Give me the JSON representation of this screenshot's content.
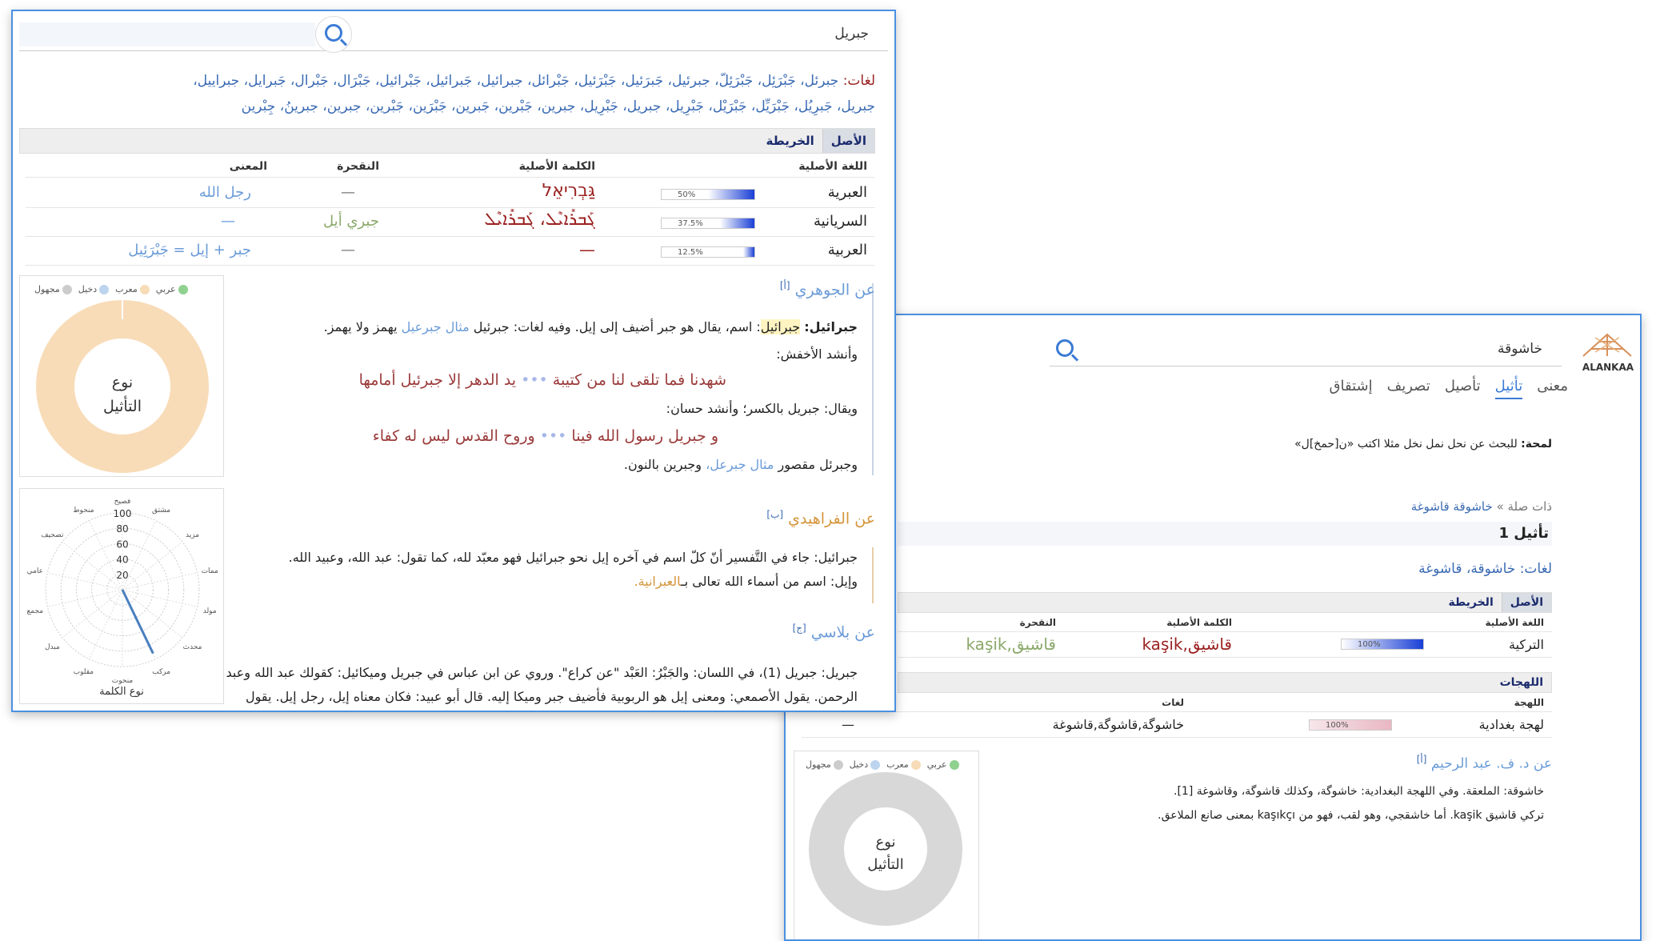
{
  "winA": {
    "search": {
      "query": "جبريل"
    },
    "variants_label": "لغات:",
    "variants_line1": "جبرئل، جَبْرَئِل، جَبْرَئِلّ، جبرئيل، جَبرَئيل، جَبْرَئيل، جَبْرائل، جبرائيل، جَبرائيل، جَبْرائيل، جَبْرَال، جَبْرال، جَبرايل، جبراييل،",
    "variants_line2": "جبريل، جَبرِيُل، جَبْرَيِّل، جَبْرَيْل، جَبْرِيل، جبريل، جَبْرِيل، جبرين، جَبْرين، جَبرين، جَبْرَين، جَبْرين، جبرين، جبرينُ، جِبْرين",
    "tabs": [
      "الأصل",
      "الخريطة"
    ],
    "table": {
      "headers": {
        "lang": "اللغة الأصلية",
        "word": "الكلمة الأصلية",
        "translit": "النقحرة",
        "meaning": "المعنى"
      },
      "rows": [
        {
          "lang": "العبرية",
          "pct": "50%",
          "fill": 0.5,
          "word": "גַּבְרִיאֵל",
          "translit": "—",
          "meaning": "رجل الله"
        },
        {
          "lang": "السريانية",
          "pct": "37.5%",
          "fill": 0.375,
          "word": "ܓܰܒܪܺܐܝܶܠ، ܓܰܒܪܺܐܝܶܠ",
          "translit": "جبري أيل",
          "meaning": "—"
        },
        {
          "lang": "العربية",
          "pct": "12.5%",
          "fill": 0.125,
          "word": "—",
          "translit": "—",
          "meaning": "جبر + إيل = جَبْرَئِيل"
        }
      ]
    },
    "legend": [
      "عربي",
      "معرب",
      "دخيل",
      "مجهول"
    ],
    "legend_colors": [
      "#8fd18f",
      "#f8dcb8",
      "#bcd4ee",
      "#cccccc"
    ],
    "donut_label": "نوع التأثيل",
    "donut_label1": "نوع",
    "donut_label2": "التأثيل",
    "radar": {
      "labels": [
        "فصيح",
        "مشتق",
        "مزيد",
        "ممات",
        "مولد",
        "محدث",
        "مركب",
        "منحوت",
        "مقلوب",
        "مبدل",
        "مجمع",
        "عامي",
        "تصحيف",
        "منحوط"
      ],
      "ticks": [
        "100",
        "80",
        "60",
        "40",
        "20"
      ],
      "caption": "نوع الكلمة"
    },
    "sec1": {
      "title": "عن الجوهري",
      "ref": "[أ]",
      "p1_bold": "جبرائيل:",
      "p1_hl": "جبرائيل",
      "p1_rest": ": اسم، يقال هو جبر أضيف إلى إيل. وفيه لغات: جبرئيل",
      "p1_link": "مثال جبرعيل",
      "p1_end": "يهمز ولا يهمز.",
      "p2": "وأنشد الأخفش:",
      "poem1_a": "شهدنا فما تلقى لنا من كتيبة",
      "poem1_b": "يد الدهر إلا جبرئيل أمامها",
      "p3": "ويقال: جبريل بالكسر؛ وأنشد حسان:",
      "poem2_a": "و جبريل رسول الله فينا",
      "poem2_b": "وروح القدس ليس له كفاء",
      "p4_a": "وجبرئل مقصور",
      "p4_link": "مثال جبرعل،",
      "p4_b": "وجبرين بالنون."
    },
    "sec2": {
      "title": "عن الفراهيدي",
      "ref": "[ب]",
      "p1": "جبرائيل: جاء في التَّفسير أنّ كلّ اسم في آخره إيل نحو جبرائيل فهو معبّد لله، كما تقول: عبد الله، وعبيد الله.",
      "p2_a": "وإيل: اسم من أسماء الله تعالى بـ",
      "p2_link": "العبرانية."
    },
    "sec3": {
      "title": "عن بلاسي",
      "ref": "[ج]",
      "p1": "جبريل: جبريل (1)، في اللسان: والجَبْرُ: العَبْد \"عن كراع\". وروي عن ابن عباس في جبريل وميكائيل: كقولك عبد الله وعبد",
      "p2": "الرحمن. يقول الأصمعي: ومعنى إيل هو الربوبية فأضيف جبر وميكا إليه. قال أبو عبيد: فكان معناه إيل، رجل إيل. يقول"
    }
  },
  "winB": {
    "logo": "ALANKAA",
    "search": {
      "query": "خاشوقة"
    },
    "nav": [
      "معنى",
      "تأثيل",
      "تأصيل",
      "تصريف",
      "إشتقاق"
    ],
    "hint_label": "لمحة:",
    "hint_text": "للبحث عن نحل نمل نخل مثلا اكتب «ن[حمخ]ل»",
    "related_label": "ذات صلة »",
    "related_links": "خاشوقة قاشوغة",
    "heading": "تأثيل 1",
    "variants_label": "لغات:",
    "variants": "خاشوقة، قاشوغة",
    "tabs": [
      "الأصل",
      "الخريطة"
    ],
    "table": {
      "headers": {
        "lang": "اللغة الأصلية",
        "word": "الكلمة الأصلية",
        "translit": "النقحرة"
      },
      "row": {
        "lang": "التركية",
        "pct": "100%",
        "fill": 1.0,
        "word_ar": "قاشيق",
        "word_lat": "kaşik",
        "translit_ar": "قاشيق",
        "translit_lat": "kaşik"
      }
    },
    "dialects": {
      "title": "اللهجات",
      "headers": {
        "dialect": "اللهجة",
        "variants": "لغات"
      },
      "row": {
        "dialect": "لهجة بغدادية",
        "pct": "100%",
        "fill": 1.0,
        "variants": "خاشوگة,قاشوگة,قاشوغة",
        "dash": "—"
      }
    },
    "sec": {
      "title": "عن د. ف. عبد الرحيم",
      "ref": "[أ]",
      "p1": "خاشوقة: الملعقة. وفي اللهجة البغدادية: خاشوگة، وكذلك قاشوگة، وقاشوغة [1].",
      "p2": "تركي قاشيق kaşik. أما خاشقجي، وهو لقب، فهو من kaşıkçı بمعنى صانع الملاعق."
    },
    "legend": [
      "عربي",
      "معرب",
      "دخيل",
      "مجهول"
    ],
    "donut_label1": "نوع",
    "donut_label2": "التأثيل"
  }
}
